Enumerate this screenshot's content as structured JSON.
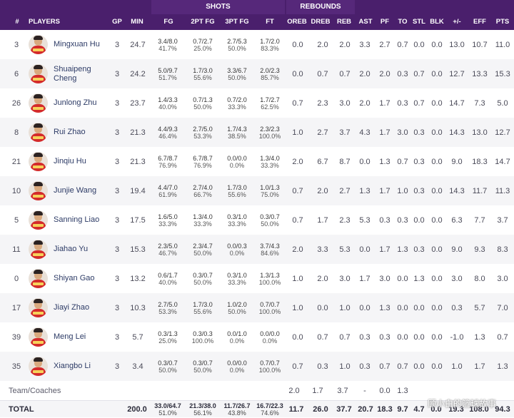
{
  "groups": {
    "shots": "SHOTS",
    "rebounds": "REBOUNDS"
  },
  "columns": [
    "#",
    "PLAYERS",
    "GP",
    "MIN",
    "FG",
    "2PT FG",
    "3PT FG",
    "FT",
    "OREB",
    "DREB",
    "REB",
    "AST",
    "PF",
    "TO",
    "STL",
    "BLK",
    "+/-",
    "EFF",
    "PTS"
  ],
  "players": [
    {
      "num": "3",
      "name": "Mingxuan Hu",
      "gp": "3",
      "min": "24.7",
      "fg": [
        "3.4/8.0",
        "41.7%"
      ],
      "fg2": [
        "0.7/2.7",
        "25.0%"
      ],
      "fg3": [
        "2.7/5.3",
        "50.0%"
      ],
      "ft": [
        "1.7/2.0",
        "83.3%"
      ],
      "oreb": "0.0",
      "dreb": "2.0",
      "reb": "2.0",
      "ast": "3.3",
      "pf": "2.7",
      "to": "0.7",
      "stl": "0.0",
      "blk": "0.0",
      "pm": "13.0",
      "eff": "10.7",
      "pts": "11.0"
    },
    {
      "num": "6",
      "name": "Shuaipeng Cheng",
      "gp": "3",
      "min": "24.2",
      "fg": [
        "5.0/9.7",
        "51.7%"
      ],
      "fg2": [
        "1.7/3.0",
        "55.6%"
      ],
      "fg3": [
        "3.3/6.7",
        "50.0%"
      ],
      "ft": [
        "2.0/2.3",
        "85.7%"
      ],
      "oreb": "0.0",
      "dreb": "0.7",
      "reb": "0.7",
      "ast": "2.0",
      "pf": "2.0",
      "to": "0.3",
      "stl": "0.7",
      "blk": "0.0",
      "pm": "12.7",
      "eff": "13.3",
      "pts": "15.3"
    },
    {
      "num": "26",
      "name": "Junlong Zhu",
      "gp": "3",
      "min": "23.7",
      "fg": [
        "1.4/3.3",
        "40.0%"
      ],
      "fg2": [
        "0.7/1.3",
        "50.0%"
      ],
      "fg3": [
        "0.7/2.0",
        "33.3%"
      ],
      "ft": [
        "1.7/2.7",
        "62.5%"
      ],
      "oreb": "0.7",
      "dreb": "2.3",
      "reb": "3.0",
      "ast": "2.0",
      "pf": "1.7",
      "to": "0.3",
      "stl": "0.7",
      "blk": "0.0",
      "pm": "14.7",
      "eff": "7.3",
      "pts": "5.0"
    },
    {
      "num": "8",
      "name": "Rui Zhao",
      "gp": "3",
      "min": "21.3",
      "fg": [
        "4.4/9.3",
        "46.4%"
      ],
      "fg2": [
        "2.7/5.0",
        "53.3%"
      ],
      "fg3": [
        "1.7/4.3",
        "38.5%"
      ],
      "ft": [
        "2.3/2.3",
        "100.0%"
      ],
      "oreb": "1.0",
      "dreb": "2.7",
      "reb": "3.7",
      "ast": "4.3",
      "pf": "1.7",
      "to": "3.0",
      "stl": "0.3",
      "blk": "0.0",
      "pm": "14.3",
      "eff": "13.0",
      "pts": "12.7"
    },
    {
      "num": "21",
      "name": "Jinqiu Hu",
      "gp": "3",
      "min": "21.3",
      "fg": [
        "6.7/8.7",
        "76.9%"
      ],
      "fg2": [
        "6.7/8.7",
        "76.9%"
      ],
      "fg3": [
        "0.0/0.0",
        "0.0%"
      ],
      "ft": [
        "1.3/4.0",
        "33.3%"
      ],
      "oreb": "2.0",
      "dreb": "6.7",
      "reb": "8.7",
      "ast": "0.0",
      "pf": "1.3",
      "to": "0.7",
      "stl": "0.3",
      "blk": "0.0",
      "pm": "9.0",
      "eff": "18.3",
      "pts": "14.7"
    },
    {
      "num": "10",
      "name": "Junjie Wang",
      "gp": "3",
      "min": "19.4",
      "fg": [
        "4.4/7.0",
        "61.9%"
      ],
      "fg2": [
        "2.7/4.0",
        "66.7%"
      ],
      "fg3": [
        "1.7/3.0",
        "55.6%"
      ],
      "ft": [
        "1.0/1.3",
        "75.0%"
      ],
      "oreb": "0.7",
      "dreb": "2.0",
      "reb": "2.7",
      "ast": "1.3",
      "pf": "1.7",
      "to": "1.0",
      "stl": "0.3",
      "blk": "0.0",
      "pm": "14.3",
      "eff": "11.7",
      "pts": "11.3"
    },
    {
      "num": "5",
      "name": "Sanning Liao",
      "gp": "3",
      "min": "17.5",
      "fg": [
        "1.6/5.0",
        "33.3%"
      ],
      "fg2": [
        "1.3/4.0",
        "33.3%"
      ],
      "fg3": [
        "0.3/1.0",
        "33.3%"
      ],
      "ft": [
        "0.3/0.7",
        "50.0%"
      ],
      "oreb": "0.7",
      "dreb": "1.7",
      "reb": "2.3",
      "ast": "5.3",
      "pf": "0.3",
      "to": "0.3",
      "stl": "0.0",
      "blk": "0.0",
      "pm": "6.3",
      "eff": "7.7",
      "pts": "3.7"
    },
    {
      "num": "11",
      "name": "Jiahao Yu",
      "gp": "3",
      "min": "15.3",
      "fg": [
        "2.3/5.0",
        "46.7%"
      ],
      "fg2": [
        "2.3/4.7",
        "50.0%"
      ],
      "fg3": [
        "0.0/0.3",
        "0.0%"
      ],
      "ft": [
        "3.7/4.3",
        "84.6%"
      ],
      "oreb": "2.0",
      "dreb": "3.3",
      "reb": "5.3",
      "ast": "0.0",
      "pf": "1.7",
      "to": "1.3",
      "stl": "0.3",
      "blk": "0.0",
      "pm": "9.0",
      "eff": "9.3",
      "pts": "8.3"
    },
    {
      "num": "0",
      "name": "Shiyan Gao",
      "gp": "3",
      "min": "13.2",
      "fg": [
        "0.6/1.7",
        "40.0%"
      ],
      "fg2": [
        "0.3/0.7",
        "50.0%"
      ],
      "fg3": [
        "0.3/1.0",
        "33.3%"
      ],
      "ft": [
        "1.3/1.3",
        "100.0%"
      ],
      "oreb": "1.0",
      "dreb": "2.0",
      "reb": "3.0",
      "ast": "1.7",
      "pf": "3.0",
      "to": "0.0",
      "stl": "1.3",
      "blk": "0.0",
      "pm": "3.0",
      "eff": "8.0",
      "pts": "3.0"
    },
    {
      "num": "17",
      "name": "Jiayi Zhao",
      "gp": "3",
      "min": "10.3",
      "fg": [
        "2.7/5.0",
        "53.3%"
      ],
      "fg2": [
        "1.7/3.0",
        "55.6%"
      ],
      "fg3": [
        "1.0/2.0",
        "50.0%"
      ],
      "ft": [
        "0.7/0.7",
        "100.0%"
      ],
      "oreb": "1.0",
      "dreb": "0.0",
      "reb": "1.0",
      "ast": "0.0",
      "pf": "1.3",
      "to": "0.0",
      "stl": "0.0",
      "blk": "0.0",
      "pm": "0.3",
      "eff": "5.7",
      "pts": "7.0"
    },
    {
      "num": "39",
      "name": "Meng Lei",
      "gp": "3",
      "min": "5.7",
      "fg": [
        "0.3/1.3",
        "25.0%"
      ],
      "fg2": [
        "0.3/0.3",
        "100.0%"
      ],
      "fg3": [
        "0.0/1.0",
        "0.0%"
      ],
      "ft": [
        "0.0/0.0",
        "0.0%"
      ],
      "oreb": "0.0",
      "dreb": "0.7",
      "reb": "0.7",
      "ast": "0.3",
      "pf": "0.3",
      "to": "0.0",
      "stl": "0.0",
      "blk": "0.0",
      "pm": "-1.0",
      "eff": "1.3",
      "pts": "0.7"
    },
    {
      "num": "35",
      "name": "Xiangbo Li",
      "gp": "3",
      "min": "3.4",
      "fg": [
        "0.3/0.7",
        "50.0%"
      ],
      "fg2": [
        "0.3/0.7",
        "50.0%"
      ],
      "fg3": [
        "0.0/0.0",
        "0.0%"
      ],
      "ft": [
        "0.7/0.7",
        "100.0%"
      ],
      "oreb": "0.7",
      "dreb": "0.3",
      "reb": "1.0",
      "ast": "0.3",
      "pf": "0.7",
      "to": "0.7",
      "stl": "0.0",
      "blk": "0.0",
      "pm": "1.0",
      "eff": "1.7",
      "pts": "1.3"
    }
  ],
  "team": {
    "label": "Team/Coaches",
    "oreb": "2.0",
    "dreb": "1.7",
    "reb": "3.7",
    "ast": "-",
    "pf": "0.0",
    "to": "1.3"
  },
  "total": {
    "label": "TOTAL",
    "min": "200.0",
    "fg": [
      "33.0/64.7",
      "51.0%"
    ],
    "fg2": [
      "21.3/38.0",
      "56.1%"
    ],
    "fg3": [
      "11.7/26.7",
      "43.8%"
    ],
    "ft": [
      "16.7/22.3",
      "74.6%"
    ],
    "oreb": "11.7",
    "dreb": "26.0",
    "reb": "37.7",
    "ast": "20.7",
    "pf": "18.3",
    "to": "9.7",
    "stl": "4.7",
    "blk": "0.0",
    "pm": "19.3",
    "eff": "108.0",
    "pts": "94.3"
  },
  "watermark": "顾小白的篮球故事"
}
